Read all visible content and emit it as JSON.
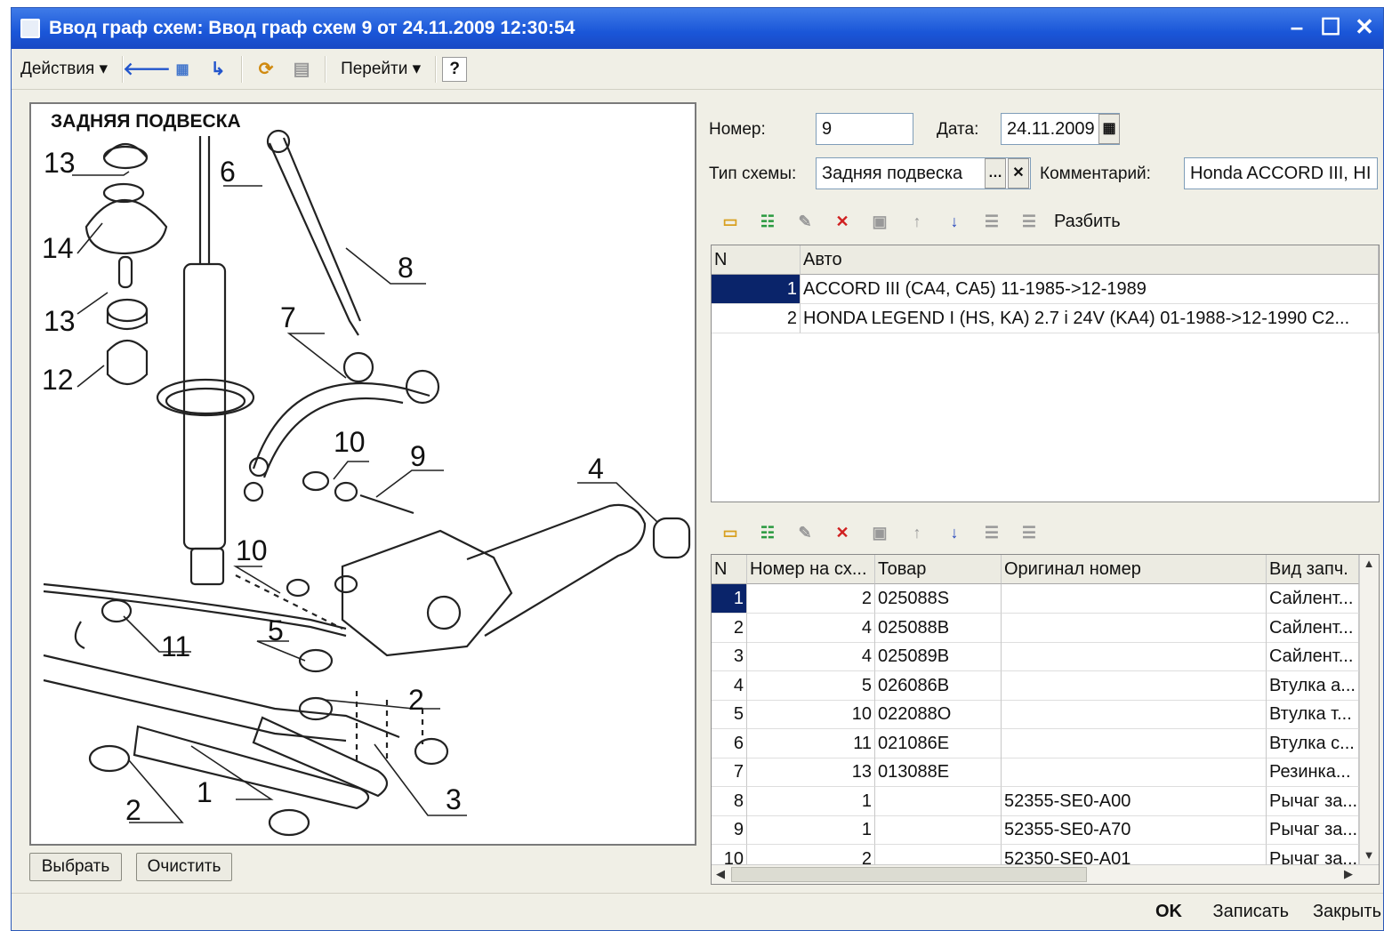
{
  "window": {
    "title": "Ввод граф схем: Ввод граф схем 9 от 24.11.2009 12:30:54",
    "min_icon": "minimize-icon",
    "max_icon": "maximize-icon",
    "close_icon": "close-icon"
  },
  "toolbar": {
    "actions_label": "Действия ▾",
    "goto_label": "Перейти ▾",
    "help_label": "?"
  },
  "diagram": {
    "title": "ЗАДНЯЯ ПОДВЕСКА",
    "callouts": [
      "13",
      "6",
      "14",
      "8",
      "13",
      "7",
      "12",
      "10",
      "9",
      "4",
      "10",
      "11",
      "5",
      "2",
      "2",
      "1",
      "3"
    ]
  },
  "buttons": {
    "select": "Выбрать",
    "clear": "Очистить"
  },
  "form": {
    "number_label": "Номер:",
    "number_value": "9",
    "date_label": "Дата:",
    "date_value": "24.11.2009",
    "scheme_type_label": "Тип схемы:",
    "scheme_type_value": "Задняя подвеска",
    "comment_label": "Комментарий:",
    "comment_value": "Honda ACCORD III, HI"
  },
  "cars_toolbar": {
    "split_label": "Разбить"
  },
  "cars_table": {
    "columns": [
      "N",
      "Авто"
    ],
    "rows": [
      {
        "n": "1",
        "auto": "ACCORD III (CA4, CA5) 11-1985->12-1989"
      },
      {
        "n": "2",
        "auto": "HONDA LEGEND I (HS, KA)  2.7 i 24V (KA4)  01-1988->12-1990 C2..."
      }
    ]
  },
  "parts_table": {
    "columns": [
      "N",
      "Номер на сх...",
      "Товар",
      "Оригинал номер",
      "Вид запч."
    ],
    "rows": [
      {
        "n": "1",
        "pos": "2",
        "item": "025088S",
        "orig": "",
        "kind": "Сайлент..."
      },
      {
        "n": "2",
        "pos": "4",
        "item": "025088B",
        "orig": "",
        "kind": "Сайлент..."
      },
      {
        "n": "3",
        "pos": "4",
        "item": "025089B",
        "orig": "",
        "kind": "Сайлент..."
      },
      {
        "n": "4",
        "pos": "5",
        "item": "026086B",
        "orig": "",
        "kind": "Втулка а..."
      },
      {
        "n": "5",
        "pos": "10",
        "item": "022088O",
        "orig": "",
        "kind": "Втулка т..."
      },
      {
        "n": "6",
        "pos": "11",
        "item": "021086E",
        "orig": "",
        "kind": "Втулка с..."
      },
      {
        "n": "7",
        "pos": "13",
        "item": "013088E",
        "orig": "",
        "kind": "Резинка..."
      },
      {
        "n": "8",
        "pos": "1",
        "item": "",
        "orig": "52355-SE0-A00",
        "kind": "Рычаг за..."
      },
      {
        "n": "9",
        "pos": "1",
        "item": "",
        "orig": "52355-SE0-A70",
        "kind": "Рычаг за..."
      },
      {
        "n": "10",
        "pos": "2",
        "item": "",
        "orig": "52350-SE0-A01",
        "kind": "Рычаг за..."
      }
    ]
  },
  "footer": {
    "ok": "OK",
    "save": "Записать",
    "close": "Закрыть"
  }
}
